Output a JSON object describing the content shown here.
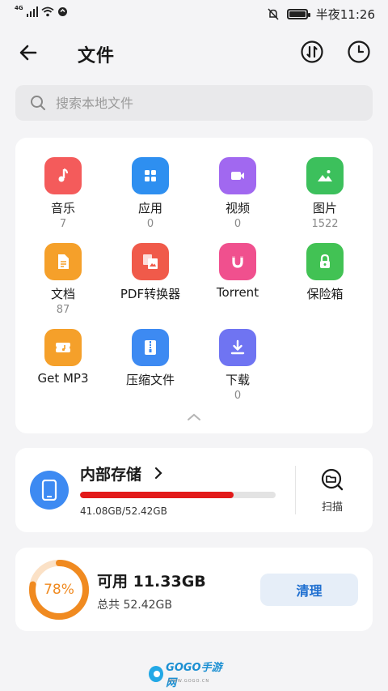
{
  "status_bar": {
    "network": "4G",
    "time": "半夜11:26"
  },
  "header": {
    "title": "文件"
  },
  "search": {
    "placeholder": "搜索本地文件"
  },
  "categories": [
    {
      "label": "音乐",
      "count": "7",
      "icon": "music-icon",
      "color": "#f45b5b"
    },
    {
      "label": "应用",
      "count": "0",
      "icon": "apps-icon",
      "color": "#2e8ff0"
    },
    {
      "label": "视频",
      "count": "0",
      "icon": "video-icon",
      "color": "#a168f0"
    },
    {
      "label": "图片",
      "count": "1522",
      "icon": "image-icon",
      "color": "#3cc05c"
    },
    {
      "label": "文档",
      "count": "87",
      "icon": "document-icon",
      "color": "#f5a02a"
    },
    {
      "label": "PDF转换器",
      "count": "",
      "icon": "pdf-convert-icon",
      "color": "#f05a4a"
    },
    {
      "label": "Torrent",
      "count": "",
      "icon": "torrent-magnet-icon",
      "color": "#f0508e"
    },
    {
      "label": "保险箱",
      "count": "",
      "icon": "safe-lock-icon",
      "color": "#42c254"
    },
    {
      "label": "Get MP3",
      "count": "",
      "icon": "get-mp3-icon",
      "color": "#f5a02a"
    },
    {
      "label": "压缩文件",
      "count": "",
      "icon": "archive-icon",
      "color": "#3d8af2"
    },
    {
      "label": "下载",
      "count": "0",
      "icon": "download-icon",
      "color": "#6f74f2"
    }
  ],
  "storage": {
    "title": "内部存储",
    "usage_text": "41.08GB/52.42GB",
    "used_fraction": 0.784,
    "bar_color": "#e21a1a",
    "scan_label": "扫描"
  },
  "cleanup": {
    "percent_text": "78%",
    "percent": 78,
    "available_text": "可用 11.33GB",
    "total_text": "总共 52.42GB",
    "clean_label": "清理",
    "ring_color": "#f08a20"
  },
  "watermark": {
    "text": "GOGO手游网",
    "sub": "WWW.GOGO.CN"
  }
}
